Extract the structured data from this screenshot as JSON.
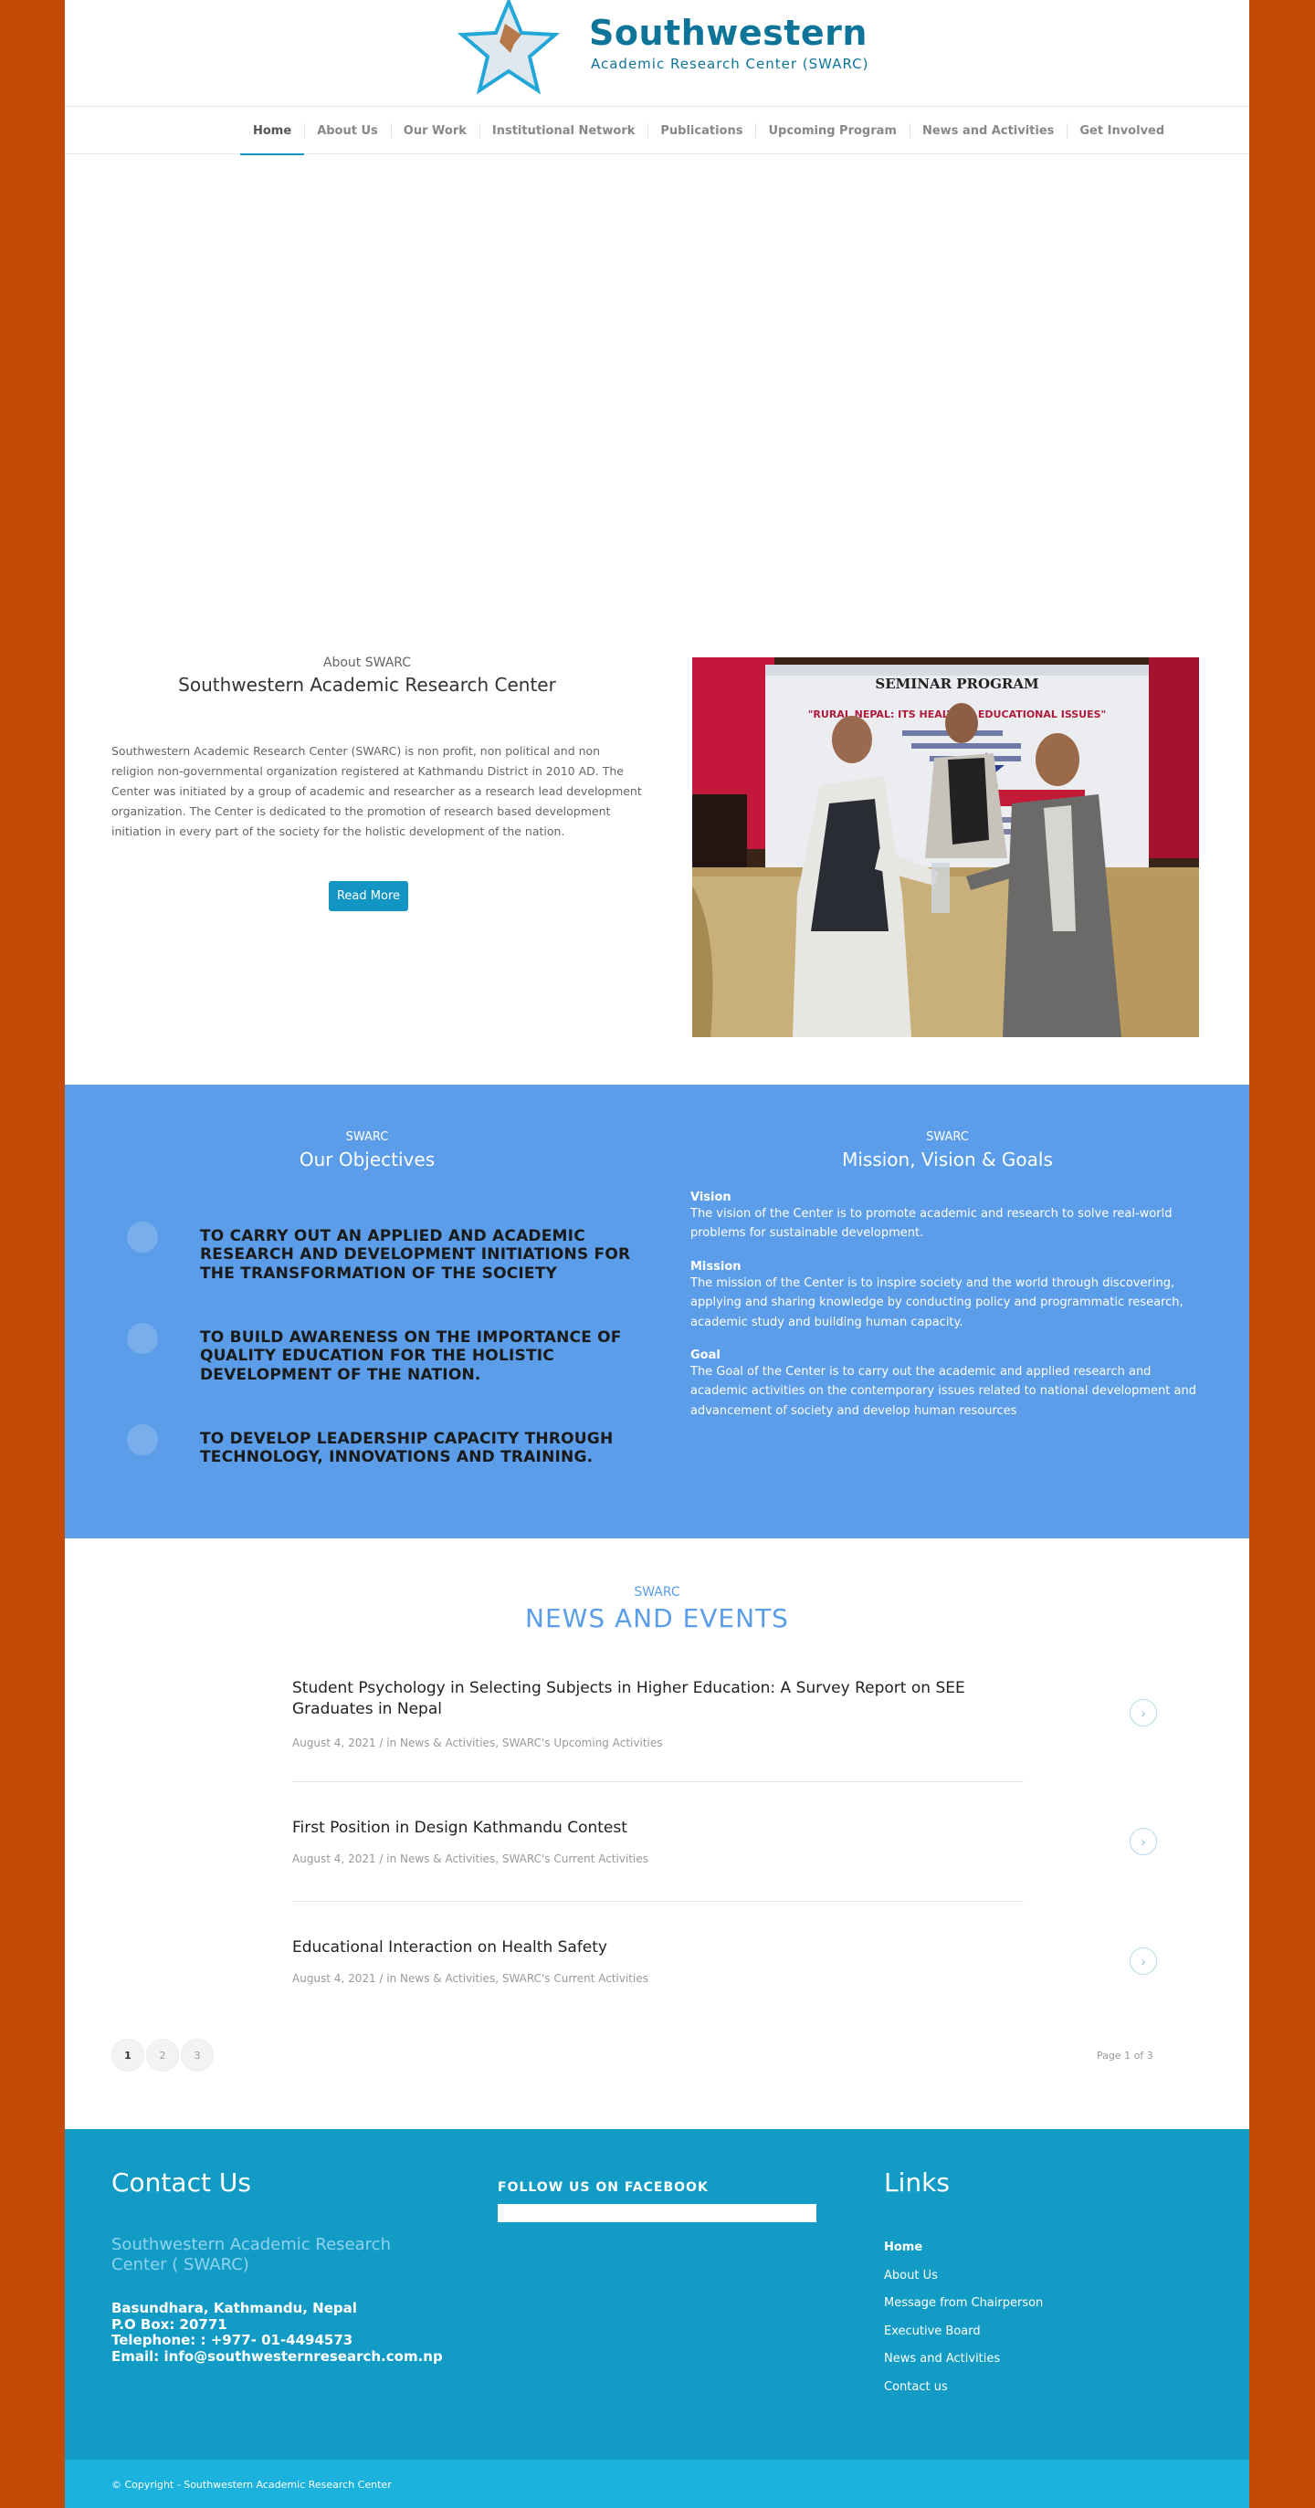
{
  "brand": {
    "title": "Southwestern",
    "subtitle": "Academic Research Center (SWARC)"
  },
  "nav": {
    "items": [
      {
        "label": "Home",
        "active": true
      },
      {
        "label": "About Us"
      },
      {
        "label": "Our Work"
      },
      {
        "label": "Institutional Network"
      },
      {
        "label": "Publications"
      },
      {
        "label": "Upcoming Program"
      },
      {
        "label": "News and Activities"
      },
      {
        "label": "Get Involved"
      }
    ]
  },
  "about": {
    "sub": "About SWARC",
    "title": "Southwestern Academic Research Center",
    "text": "Southwestern Academic Research Center (SWARC) is non profit, non political and non religion non-governmental organization registered at Kathmandu District in 2010 AD. The Center was initiated by a group of academic and researcher as a research lead development organization. The Center is dedicated to the promotion of research based development initiation in every part of the society for the holistic development of the nation.",
    "button": "Read More",
    "photo": {
      "banner_line1": "SEMINAR PROGRAM",
      "banner_line2": "\"RURAL NEPAL: ITS HEALTH & EDUCATIONAL ISSUES\""
    }
  },
  "objectives": {
    "sub": "SWARC",
    "title": "Our Objectives",
    "items": [
      "TO CARRY OUT AN APPLIED AND ACADEMIC RESEARCH AND DEVELOPMENT INITIATIONS FOR THE TRANSFORMATION OF THE SOCIETY",
      "TO BUILD AWARENESS ON THE IMPORTANCE OF QUALITY EDUCATION FOR THE HOLISTIC DEVELOPMENT OF THE NATION.",
      "TO DEVELOP LEADERSHIP CAPACITY THROUGH TECHNOLOGY, INNOVATIONS AND TRAINING."
    ]
  },
  "mvg": {
    "sub": "SWARC",
    "title": "Mission, Vision & Goals",
    "vision_h": "Vision",
    "vision_t": "The vision of the Center is to promote academic and research to solve real-world problems for sustainable development.",
    "mission_h": "Mission",
    "mission_t": "The mission of the Center is to inspire society and the world through discovering, applying and sharing knowledge by conducting policy and programmatic research, academic study and building human capacity.",
    "goal_h": "Goal",
    "goal_t": "The Goal of the Center is to carry out the academic and applied research and academic activities on the contemporary issues related to national development and advancement of society and develop human resources"
  },
  "news": {
    "sub": "SWARC",
    "title": "NEWS AND EVENTS",
    "items": [
      {
        "title": "Student Psychology in Selecting Subjects in Higher Education: A Survey Report on SEE Graduates in Nepal",
        "meta": "August 4, 2021  /  in News & Activities, SWARC's Upcoming Activities"
      },
      {
        "title": "First Position in Design Kathmandu Contest",
        "meta": "August 4, 2021  /  in News & Activities, SWARC's Current Activities"
      },
      {
        "title": "Educational Interaction on Health Safety",
        "meta": "August 4, 2021  /  in News & Activities, SWARC's Current Activities"
      }
    ],
    "arrow": "›",
    "pages": [
      "1",
      "2",
      "3"
    ],
    "page_of": "Page 1 of 3"
  },
  "footer": {
    "contact_title": "Contact Us",
    "org": "Southwestern Academic Research Center ( SWARC)",
    "address": "Basundhara, Kathmandu, Nepal",
    "pobox": "P.O Box: 20771",
    "phone": "Telephone: : +977- 01-4494573",
    "email": "Email: info@southwesternresearch.com.np",
    "facebook_title": "FOLLOW US ON FACEBOOK",
    "links_title": "Links",
    "links": [
      "Home",
      "About Us",
      "Message from Chairperson",
      "Executive Board",
      "News and Activities",
      "Contact us"
    ],
    "copyright": "© Copyright - Southwestern Academic Research Center"
  },
  "colors": {
    "page_bg": "#c44b07",
    "accent": "#1295c3",
    "objectives_bg": "#5b9de8",
    "footer_bg": "#129bc5",
    "copyright_bg": "#1cb2de"
  }
}
